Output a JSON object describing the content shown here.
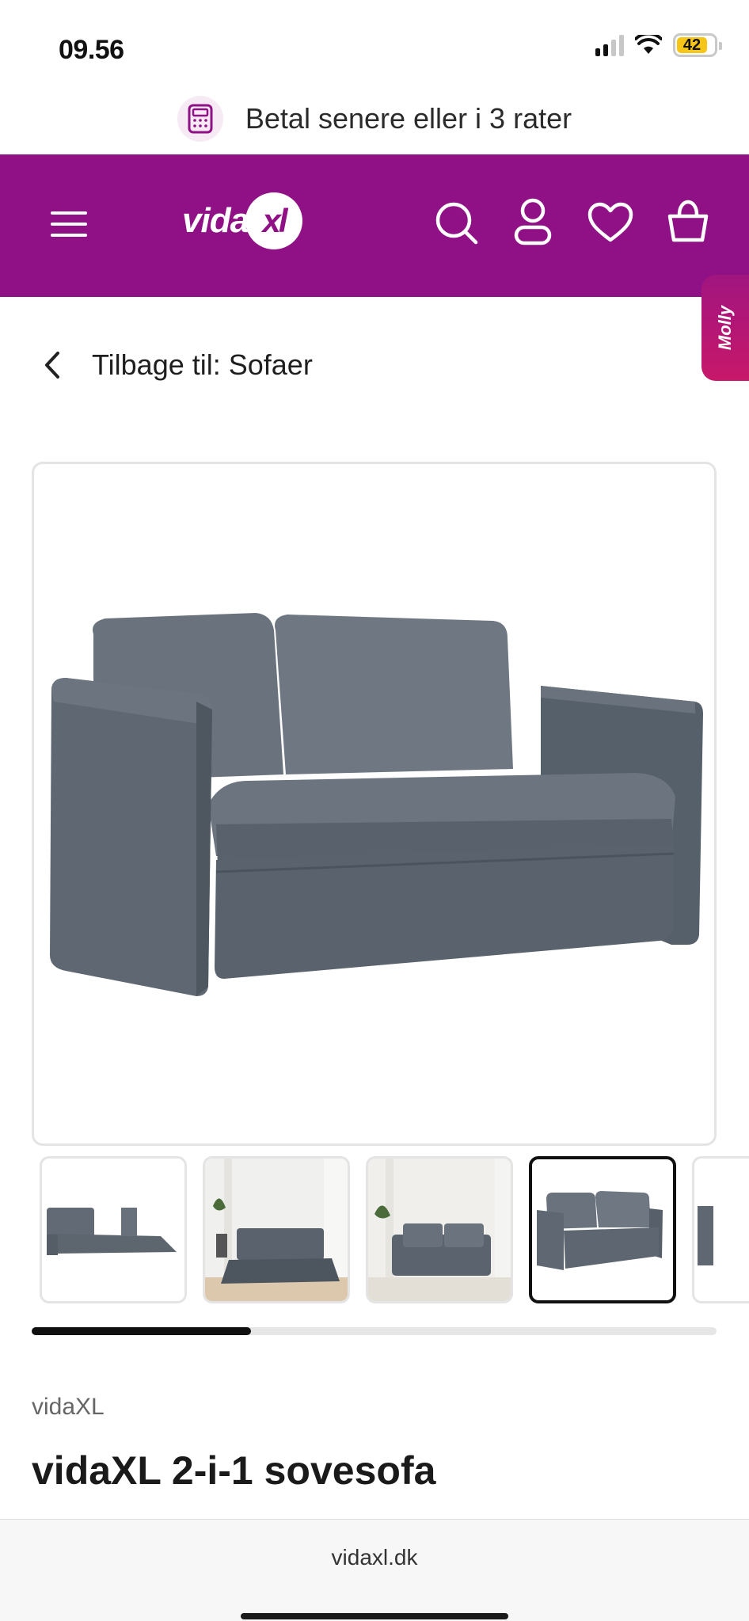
{
  "status_bar": {
    "time": "09.56",
    "battery": "42",
    "signal_bars_filled": 2,
    "signal_bars_total": 4
  },
  "promo": {
    "text": "Betal senere eller i 3 rater",
    "icon": "calculator-icon"
  },
  "header": {
    "logo": "vidaXL",
    "icons": [
      "menu-icon",
      "search-icon",
      "account-icon",
      "wishlist-icon",
      "cart-icon"
    ],
    "bg_color": "#8f1185"
  },
  "molly": {
    "label": "Molly"
  },
  "back": {
    "label": "Tilbage til: Sofaer"
  },
  "gallery": {
    "thumbnails": [
      "sofa-bed-unfolded",
      "sofa-unfolded-room",
      "sofa-room",
      "sofa-front",
      "sofa-partial"
    ],
    "active_index": 3,
    "scroll_progress": 0.32
  },
  "product": {
    "brand": "vidaXL",
    "title": "vidaXL 2-i-1 sovesofa"
  },
  "browser": {
    "url": "vidaxl.dk"
  }
}
